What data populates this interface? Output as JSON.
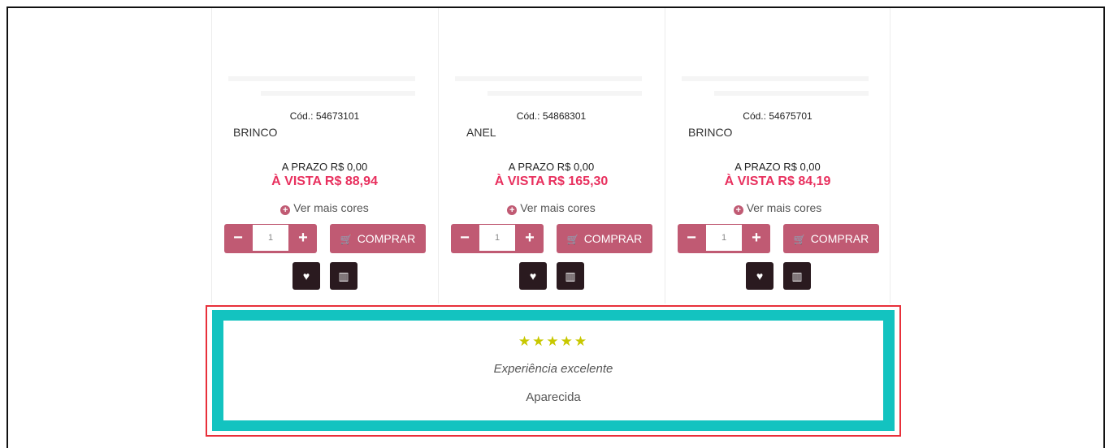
{
  "products": [
    {
      "code": "Cód.: 54673101",
      "name": "BRINCO",
      "prazo": "A PRAZO R$ 0,00",
      "vista": "À VISTA R$ 88,94",
      "cores": "Ver mais cores",
      "qty": "1",
      "buy": "COMPRAR"
    },
    {
      "code": "Cód.: 54868301",
      "name": "ANEL",
      "prazo": "A PRAZO R$ 0,00",
      "vista": "À VISTA R$ 165,30",
      "cores": "Ver mais cores",
      "qty": "1",
      "buy": "COMPRAR"
    },
    {
      "code": "Cód.: 54675701",
      "name": "BRINCO",
      "prazo": "A PRAZO R$ 0,00",
      "vista": "À VISTA R$ 84,19",
      "cores": "Ver mais cores",
      "qty": "1",
      "buy": "COMPRAR"
    }
  ],
  "review": {
    "stars": "★★★★★",
    "rating": 5,
    "text": "Experiência excelente",
    "author": "Aparecida"
  },
  "colors": {
    "accent": "#c05a73",
    "price": "#e8305e",
    "review_border": "#13c3c0",
    "highlight": "#e8303a",
    "dark_button": "#2a1a1f",
    "stars": "#c8c800"
  },
  "icons": [
    "minus-icon",
    "plus-icon",
    "cart-icon",
    "heart-icon",
    "compare-icon",
    "plus-circle-icon",
    "star-icon"
  ]
}
